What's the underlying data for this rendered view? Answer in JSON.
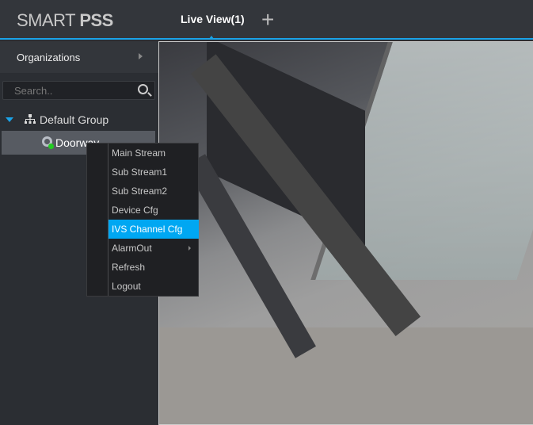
{
  "header": {
    "logo_light": "SMART ",
    "logo_bold": "PSS",
    "tab_label": "Live View(1)",
    "add_tab": "+"
  },
  "sidebar": {
    "organizations": "Organizations",
    "search_placeholder": "Search..",
    "group": "Default Group",
    "device": "Doorway"
  },
  "context_menu": {
    "items": [
      {
        "label": "Main Stream"
      },
      {
        "label": "Sub Stream1"
      },
      {
        "label": "Sub Stream2"
      },
      {
        "label": "Device Cfg"
      },
      {
        "label": "IVS Channel Cfg",
        "highlighted": true
      },
      {
        "label": "AlarmOut",
        "submenu": true
      },
      {
        "label": "Refresh"
      },
      {
        "label": "Logout"
      }
    ]
  },
  "colors": {
    "accent": "#1aa3e8",
    "highlight": "#00a7f2",
    "online": "#22cc22"
  }
}
